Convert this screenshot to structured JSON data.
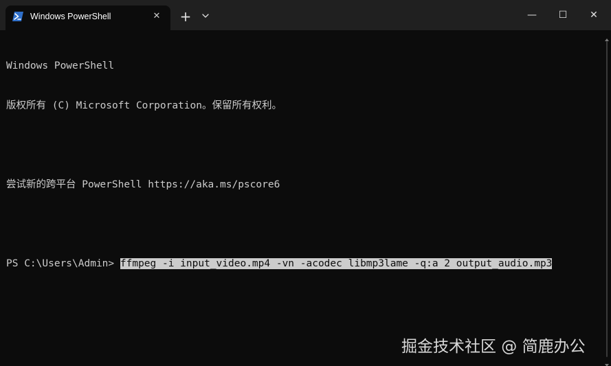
{
  "window": {
    "tab_title": "Windows PowerShell",
    "tab_close_symbol": "✕",
    "new_tab_symbol": "+",
    "minimize_symbol": "—",
    "maximize_symbol": "☐",
    "close_symbol": "✕"
  },
  "terminal": {
    "line1": "Windows PowerShell",
    "line2": "版权所有 (C) Microsoft Corporation。保留所有权利。",
    "line3": "尝试新的跨平台 PowerShell https://aka.ms/pscore6",
    "prompt": "PS C:\\Users\\Admin> ",
    "command": "ffmpeg -i input_video.mp4 -vn -acodec libmp3lame -q:a 2 output_audio.mp3"
  },
  "watermark": {
    "text": "掘金技术社区 @ 简鹿办公"
  },
  "colors": {
    "titlebar": "#202020",
    "terminal_bg": "#0c0c0c",
    "terminal_fg": "#cccccc",
    "selection_bg": "#cccccc",
    "powershell_icon": "#2f6fc9"
  },
  "icons": {
    "tab_icon": "powershell-icon",
    "dropdown": "chevron-down-icon"
  }
}
